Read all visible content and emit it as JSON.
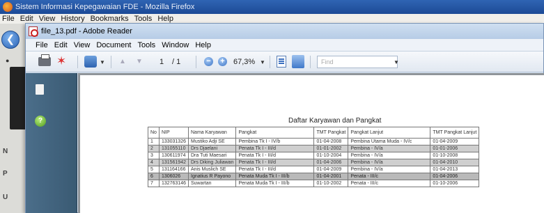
{
  "firefox": {
    "title": "Sistem Informasi Kepegawaian FDE - Mozilla Firefox",
    "menu": [
      "File",
      "Edit",
      "View",
      "History",
      "Bookmarks",
      "Tools",
      "Help"
    ],
    "side_letters": [
      "N",
      "P",
      "U"
    ]
  },
  "reader": {
    "title": "file_13.pdf - Adobe Reader",
    "menu": [
      "File",
      "Edit",
      "View",
      "Document",
      "Tools",
      "Window",
      "Help"
    ],
    "toolbar": {
      "page_current": "1",
      "page_total": "/ 1",
      "zoom": "67,3%",
      "find_placeholder": "Find"
    }
  },
  "document": {
    "title": "Daftar Karyawan dan Pangkat",
    "columns": [
      "No",
      "NIP",
      "Nama Karyawan",
      "Pangkat",
      "TMT Pangkat",
      "Pangkat Lanjut",
      "TMT Pangkat Lanjut"
    ],
    "rows": [
      [
        "1",
        "133031326",
        "Mustiko Adji SE",
        "Pembina Tk I - IV/b",
        "01-04-2008",
        "Pembina Utama Muda - IV/c",
        "01-04-2009"
      ],
      [
        "2",
        "131055110",
        "Drs Djaelani",
        "Penata Tk I - III/d",
        "01-01-2002",
        "Pembina - IV/a",
        "01-01-2006"
      ],
      [
        "3",
        "130611974",
        "Dra Tuti Maesari",
        "Penata Tk I - III/d",
        "01-10-2004",
        "Pembina - IV/a",
        "01-10-2008"
      ],
      [
        "4",
        "131561942",
        "Drs Diking Juliawan",
        "Penata Tk I - III/d",
        "01-04-2006",
        "Pembina - IV/a",
        "01-04-2010"
      ],
      [
        "5",
        "131164166",
        "Anis Muslich SE",
        "Penata Tk I - III/d",
        "01-04-2009",
        "Pembina - IV/a",
        "01-04-2013"
      ],
      [
        "6",
        "1306026",
        "Ignatius R Payono",
        "Penata Muda Tk I - III/b",
        "01-04-2001",
        "Penata - III/c",
        "01-04-2006"
      ],
      [
        "7",
        "132763146",
        "Suwartan",
        "Penata Muda Tk I - III/b",
        "01-10-2002",
        "Penata - III/c",
        "01-10-2006"
      ]
    ]
  }
}
